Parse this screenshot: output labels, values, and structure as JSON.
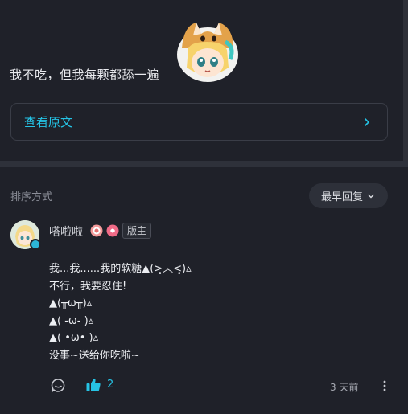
{
  "post": {
    "text": "我不吃，但我每颗都舔一遍",
    "view_original_label": "查看原文"
  },
  "comments": {
    "sort_label": "排序方式",
    "sort_selected": "最早回复",
    "items": [
      {
        "username": "嗒啦啦",
        "role_tag": "版主",
        "lines": [
          "我...我......我的软糖▲(>̥︿<̥)▵",
          "不行，我要忍住!",
          "▲(╥ω╥)▵",
          "▲( -ω- )▵",
          "▲( •ω• )▵",
          "没事~送给你吃啦~"
        ],
        "like_count": "2",
        "time": "3 天前"
      }
    ]
  },
  "icons": {
    "view_original_chevron": "chevron-right-icon",
    "sort_chevron": "chevron-down-icon",
    "reply": "comment-icon",
    "like": "thumbs-up-icon",
    "more": "more-vertical-icon"
  },
  "colors": {
    "background": "#1f2129",
    "accent": "#25c4e6",
    "divider": "#2e313a"
  }
}
